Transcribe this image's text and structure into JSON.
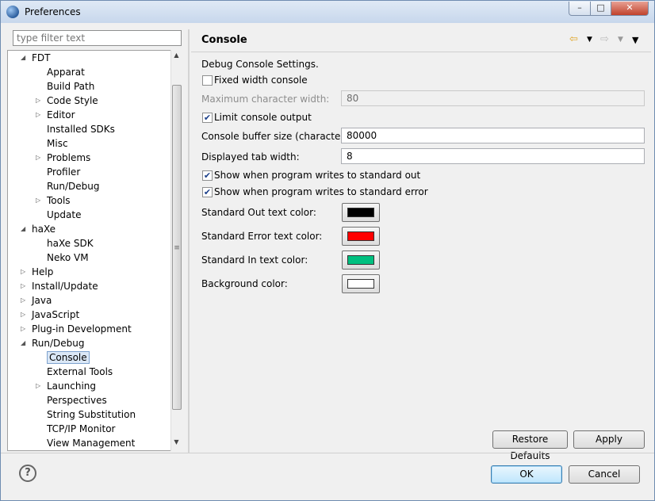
{
  "window": {
    "title": "Preferences"
  },
  "window_controls": {
    "minimize": "–",
    "maximize": "□",
    "close": "✕"
  },
  "filter": {
    "placeholder": "type filter text",
    "value": ""
  },
  "tree": [
    {
      "label": "FDT",
      "level": 0,
      "twisty": "open"
    },
    {
      "label": "Apparat",
      "level": 1,
      "twisty": "none"
    },
    {
      "label": "Build Path",
      "level": 1,
      "twisty": "none"
    },
    {
      "label": "Code Style",
      "level": 1,
      "twisty": "closed"
    },
    {
      "label": "Editor",
      "level": 1,
      "twisty": "closed"
    },
    {
      "label": "Installed SDKs",
      "level": 1,
      "twisty": "none"
    },
    {
      "label": "Misc",
      "level": 1,
      "twisty": "none"
    },
    {
      "label": "Problems",
      "level": 1,
      "twisty": "closed"
    },
    {
      "label": "Profiler",
      "level": 1,
      "twisty": "none"
    },
    {
      "label": "Run/Debug",
      "level": 1,
      "twisty": "none"
    },
    {
      "label": "Tools",
      "level": 1,
      "twisty": "closed"
    },
    {
      "label": "Update",
      "level": 1,
      "twisty": "none"
    },
    {
      "label": "haXe",
      "level": 0,
      "twisty": "open"
    },
    {
      "label": "haXe SDK",
      "level": 1,
      "twisty": "none"
    },
    {
      "label": "Neko VM",
      "level": 1,
      "twisty": "none"
    },
    {
      "label": "Help",
      "level": 0,
      "twisty": "closed"
    },
    {
      "label": "Install/Update",
      "level": 0,
      "twisty": "closed"
    },
    {
      "label": "Java",
      "level": 0,
      "twisty": "closed"
    },
    {
      "label": "JavaScript",
      "level": 0,
      "twisty": "closed"
    },
    {
      "label": "Plug-in Development",
      "level": 0,
      "twisty": "closed"
    },
    {
      "label": "Run/Debug",
      "level": 0,
      "twisty": "open"
    },
    {
      "label": "Console",
      "level": 1,
      "twisty": "none",
      "selected": true
    },
    {
      "label": "External Tools",
      "level": 1,
      "twisty": "none"
    },
    {
      "label": "Launching",
      "level": 1,
      "twisty": "closed"
    },
    {
      "label": "Perspectives",
      "level": 1,
      "twisty": "none"
    },
    {
      "label": "String Substitution",
      "level": 1,
      "twisty": "none"
    },
    {
      "label": "TCP/IP Monitor",
      "level": 1,
      "twisty": "none"
    },
    {
      "label": "View Management",
      "level": 1,
      "twisty": "none"
    }
  ],
  "page": {
    "title": "Console",
    "description": "Debug Console Settings.",
    "fixed_width": {
      "label": "Fixed width console",
      "checked": false
    },
    "max_char_width": {
      "label": "Maximum character width:",
      "value": "80"
    },
    "limit_output": {
      "label": "Limit console output",
      "checked": true
    },
    "buffer_size": {
      "label": "Console buffer size (characters):",
      "value": "80000"
    },
    "tab_width": {
      "label": "Displayed tab width:",
      "value": "8"
    },
    "show_stdout": {
      "label": "Show when program writes to standard out",
      "checked": true
    },
    "show_stderr": {
      "label": "Show when program writes to standard error",
      "checked": true
    },
    "colors": [
      {
        "label": "Standard Out text color:",
        "color": "#000000"
      },
      {
        "label": "Standard Error text color:",
        "color": "#ff0000"
      },
      {
        "label": "Standard In text color:",
        "color": "#00c080"
      },
      {
        "label": "Background color:",
        "color": "#ffffff"
      }
    ],
    "restore_defaults": "Restore Defaults",
    "apply": "Apply"
  },
  "dialog": {
    "ok": "OK",
    "cancel": "Cancel",
    "help_glyph": "?"
  }
}
